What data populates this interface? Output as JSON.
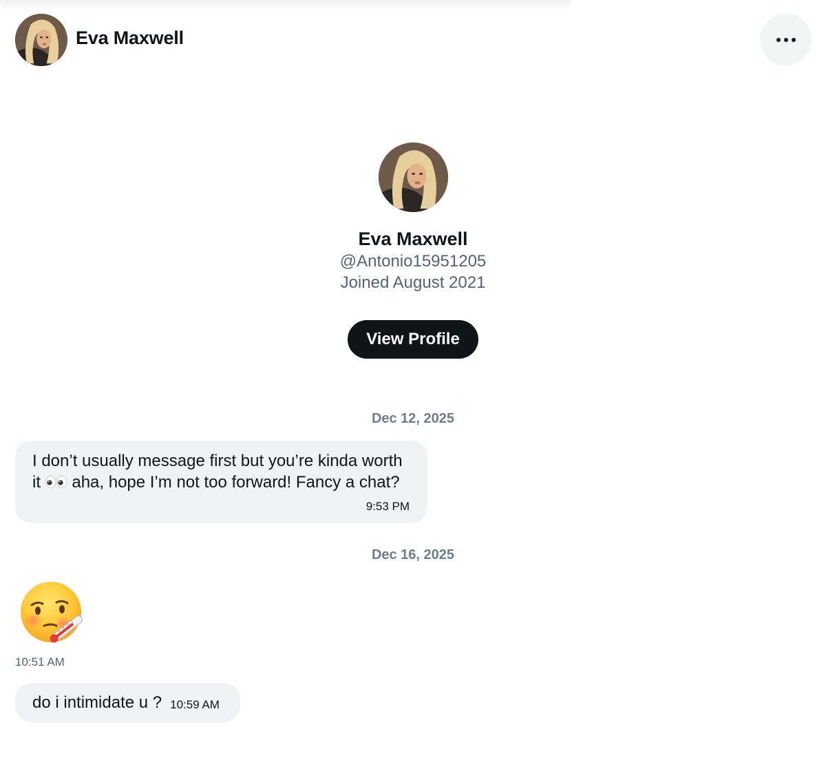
{
  "header": {
    "contact_name": "Eva Maxwell",
    "more_icon": "more-horizontal-icon"
  },
  "profile": {
    "name": "Eva Maxwell",
    "handle": "@Antonio15951205",
    "joined": "Joined August 2021",
    "view_profile_label": "View Profile"
  },
  "conversation": {
    "groups": [
      {
        "date": "Dec 12, 2025",
        "messages": [
          {
            "text_before_emoji": "I don’t usually message first but you’re kinda worth it ",
            "emoji": "eyes-emoji-icon",
            "text_after_emoji": " aha, hope I’m not too forward! Fancy a chat?",
            "time": "9:53 PM"
          }
        ]
      },
      {
        "date": "Dec 16, 2025",
        "messages": [
          {
            "emoji": "face-with-thermometer-emoji-icon",
            "time": "10:51 AM"
          },
          {
            "text": "do i intimidate u ?",
            "time": "10:59 AM"
          }
        ]
      }
    ]
  },
  "colors": {
    "bubble_bg": "#eff3f4",
    "primary_text": "#0f1419",
    "secondary_text": "#536471",
    "button_bg": "#0f1419"
  }
}
